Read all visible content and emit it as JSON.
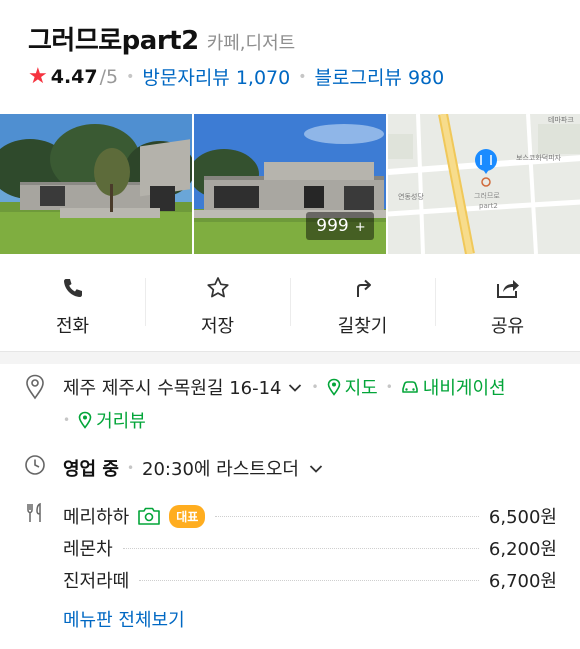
{
  "place": {
    "name": "그러므로part2",
    "category": "카페,디저트"
  },
  "rating": {
    "score": "4.47",
    "max": "/5",
    "visitor_reviews": "방문자리뷰 1,070",
    "blog_reviews": "블로그리뷰 980"
  },
  "photos": {
    "more_count": "999",
    "more_plus": "+"
  },
  "map_preview": {
    "label_top_right": "테마파크",
    "label_pin": "그러므로\npart2",
    "label_church": "연동성당",
    "label_pizza": "보스코화덕피자"
  },
  "actions": [
    {
      "label": "전화",
      "icon": "phone-icon"
    },
    {
      "label": "저장",
      "icon": "star-outline-icon"
    },
    {
      "label": "길찾기",
      "icon": "directions-icon"
    },
    {
      "label": "공유",
      "icon": "share-icon"
    }
  ],
  "address": {
    "text": "제주 제주시 수목원길 16-14",
    "map_link": "지도",
    "navigation_link": "내비게이션",
    "street_view_link": "거리뷰"
  },
  "hours": {
    "status": "영업 중",
    "detail": "20:30에 라스트오더"
  },
  "menu": {
    "items": [
      {
        "name": "메리하하",
        "price": "6,500원",
        "badge": "대표"
      },
      {
        "name": "레몬차",
        "price": "6,200원"
      },
      {
        "name": "진저라떼",
        "price": "6,700원"
      }
    ],
    "view_all": "메뉴판 전체보기"
  },
  "colors": {
    "accent_blue": "#0068c3",
    "accent_green": "#03a539",
    "star_red": "#f5333f",
    "badge_orange": "#ffad1f"
  }
}
